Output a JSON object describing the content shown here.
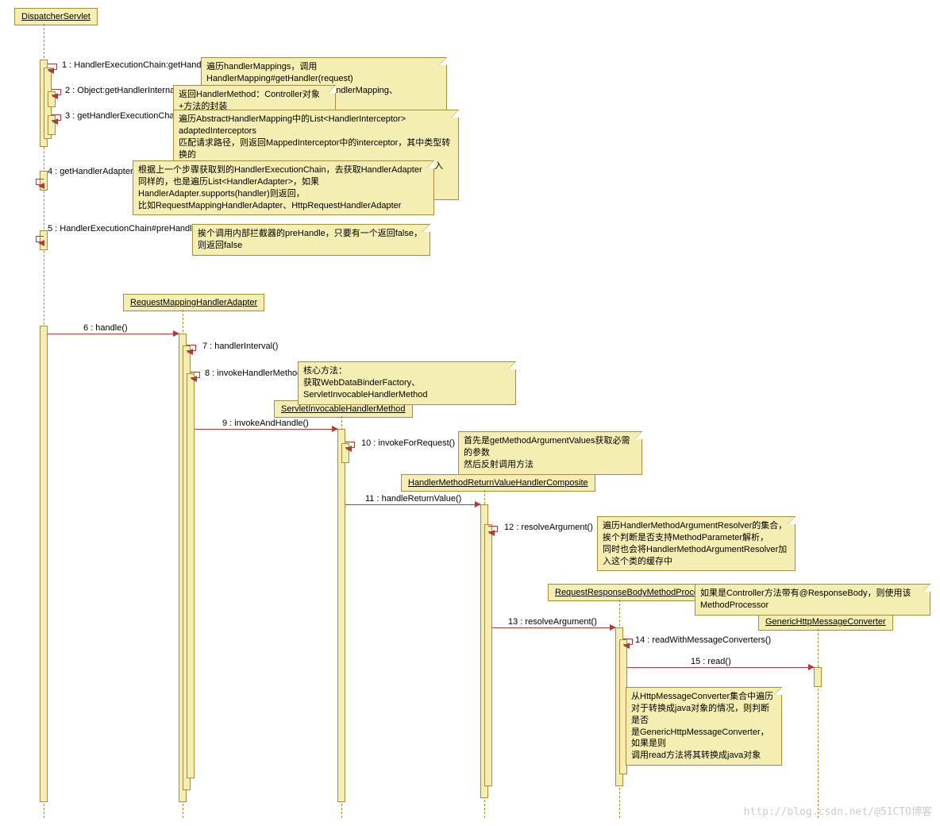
{
  "lifelines": {
    "dispatcher": "DispatcherServlet",
    "rmha": "RequestMappingHandlerAdapter",
    "sihm": "ServletInvocableHandlerMethod",
    "hmrvhc": "HandlerMethodReturnValueHandlerComposite",
    "rrbmp": "RequestResponseBodyMethodProcessor",
    "ghmc": "GenericHttpMessageConverter"
  },
  "messages": {
    "m1": "1 : HandlerExecutionChain:getHandler()",
    "m2": "2 : Object:getHandlerInternal()",
    "m3": "3 : getHandlerExecutionChain()",
    "m4": "4 : getHandlerAdapter()",
    "m5": "5 : HandlerExecutionChain#preHandler()",
    "m6": "6 : handle()",
    "m7": "7 : handlerInterval()",
    "m8": "8 : invokeHandlerMethod()",
    "m9": "9 : invokeAndHandle()",
    "m10": "10 : invokeForRequest()",
    "m11": "11 : handleReturnValue()",
    "m12": "12 : resolveArgument()",
    "m13": "13 : resolveArgument()",
    "m14": "14 : readWithMessageConverters()",
    "m15": "15 : read()"
  },
  "notes": {
    "n1": "遍历handlerMappings，调用HandlerMapping#getHandler(request)\n常见的实现类RequestMappingHandlerMapping、BeanNameUrlHandlerMapping",
    "n2": "返回HandlerMethod：Controller对象+方法的封装",
    "n3": "遍历AbstractHandlerMapping中的List<HandlerInterceptor> adaptedInterceptors\n匹配请求路径，则返回MappedInterceptor中的interceptor，其中类型转换的\n拦截器ConversionServiceExposingInterceptor就是在这个过程中加入的，另外还有\n自定义的拦截器",
    "n4": "根据上一个步骤获取到的HandlerExecutionChain，去获取HandlerAdapter\n同样的，也是遍历List<HandlerAdapter>，如果HandlerAdapter.supports(handler)则返回，\n比如RequestMappingHandlerAdapter、HttpRequestHandlerAdapter",
    "n5": "挨个调用内部拦截器的preHandle，只要有一个返回false，则返回false",
    "n8": "核心方法：\n获取WebDataBinderFactory、ServletInvocableHandlerMethod",
    "n10": "首先是getMethodArgumentValues获取必需的参数\n然后反射调用方法",
    "n12": "遍历HandlerMethodArgumentResolver的集合，\n挨个判断是否支持MethodParameter解析，\n同时也会将HandlerMethodArgumentResolver加入这个类的缓存中",
    "n13": "如果是Controller方法带有@ResponseBody，则使用该MethodProcessor",
    "n14": "从HttpMessageConverter集合中遍历\n对于转换成java对象的情况，则判断是否\n是GenericHttpMessageConverter，如果是则\n调用read方法将其转换成java对象"
  },
  "watermark": "http://blog.csdn.net/@51CTO博客",
  "chart_data": {
    "type": "sequence-diagram",
    "participants": [
      "DispatcherServlet",
      "RequestMappingHandlerAdapter",
      "ServletInvocableHandlerMethod",
      "HandlerMethodReturnValueHandlerComposite",
      "RequestResponseBodyMethodProcessor",
      "GenericHttpMessageConverter"
    ],
    "messages": [
      {
        "num": 1,
        "from": "DispatcherServlet",
        "to": "DispatcherServlet",
        "label": "HandlerExecutionChain:getHandler()"
      },
      {
        "num": 2,
        "from": "DispatcherServlet",
        "to": "DispatcherServlet",
        "label": "Object:getHandlerInternal()"
      },
      {
        "num": 3,
        "from": "DispatcherServlet",
        "to": "DispatcherServlet",
        "label": "getHandlerExecutionChain()"
      },
      {
        "num": 4,
        "from": "DispatcherServlet",
        "to": "DispatcherServlet",
        "label": "getHandlerAdapter()"
      },
      {
        "num": 5,
        "from": "DispatcherServlet",
        "to": "DispatcherServlet",
        "label": "HandlerExecutionChain#preHandler()"
      },
      {
        "num": 6,
        "from": "DispatcherServlet",
        "to": "RequestMappingHandlerAdapter",
        "label": "handle()"
      },
      {
        "num": 7,
        "from": "RequestMappingHandlerAdapter",
        "to": "RequestMappingHandlerAdapter",
        "label": "handlerInterval()"
      },
      {
        "num": 8,
        "from": "RequestMappingHandlerAdapter",
        "to": "RequestMappingHandlerAdapter",
        "label": "invokeHandlerMethod()"
      },
      {
        "num": 9,
        "from": "RequestMappingHandlerAdapter",
        "to": "ServletInvocableHandlerMethod",
        "label": "invokeAndHandle()"
      },
      {
        "num": 10,
        "from": "ServletInvocableHandlerMethod",
        "to": "ServletInvocableHandlerMethod",
        "label": "invokeForRequest()"
      },
      {
        "num": 11,
        "from": "ServletInvocableHandlerMethod",
        "to": "HandlerMethodReturnValueHandlerComposite",
        "label": "handleReturnValue()"
      },
      {
        "num": 12,
        "from": "HandlerMethodReturnValueHandlerComposite",
        "to": "HandlerMethodReturnValueHandlerComposite",
        "label": "resolveArgument()"
      },
      {
        "num": 13,
        "from": "HandlerMethodReturnValueHandlerComposite",
        "to": "RequestResponseBodyMethodProcessor",
        "label": "resolveArgument()"
      },
      {
        "num": 14,
        "from": "RequestResponseBodyMethodProcessor",
        "to": "RequestResponseBodyMethodProcessor",
        "label": "readWithMessageConverters()"
      },
      {
        "num": 15,
        "from": "RequestResponseBodyMethodProcessor",
        "to": "GenericHttpMessageConverter",
        "label": "read()"
      }
    ]
  }
}
